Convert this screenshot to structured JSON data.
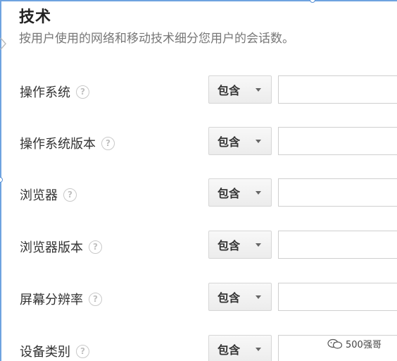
{
  "section": {
    "title": "技术",
    "description": "按用户使用的网络和移动技术细分您用户的会话数。"
  },
  "filters": [
    {
      "label": "操作系统",
      "help": "?",
      "match": "包含",
      "value": ""
    },
    {
      "label": "操作系统版本",
      "help": "?",
      "match": "包含",
      "value": ""
    },
    {
      "label": "浏览器",
      "help": "?",
      "match": "包含",
      "value": ""
    },
    {
      "label": "浏览器版本",
      "help": "?",
      "match": "包含",
      "value": ""
    },
    {
      "label": "屏幕分辨率",
      "help": "?",
      "match": "包含",
      "value": ""
    },
    {
      "label": "设备类别",
      "help": "?",
      "match": "包含",
      "value": ""
    }
  ],
  "watermark": {
    "text": "500强哥",
    "icon": "wechat-icon"
  },
  "colors": {
    "selection_border": "#6fa3e0",
    "title": "#222222",
    "subtitle": "#777777"
  }
}
